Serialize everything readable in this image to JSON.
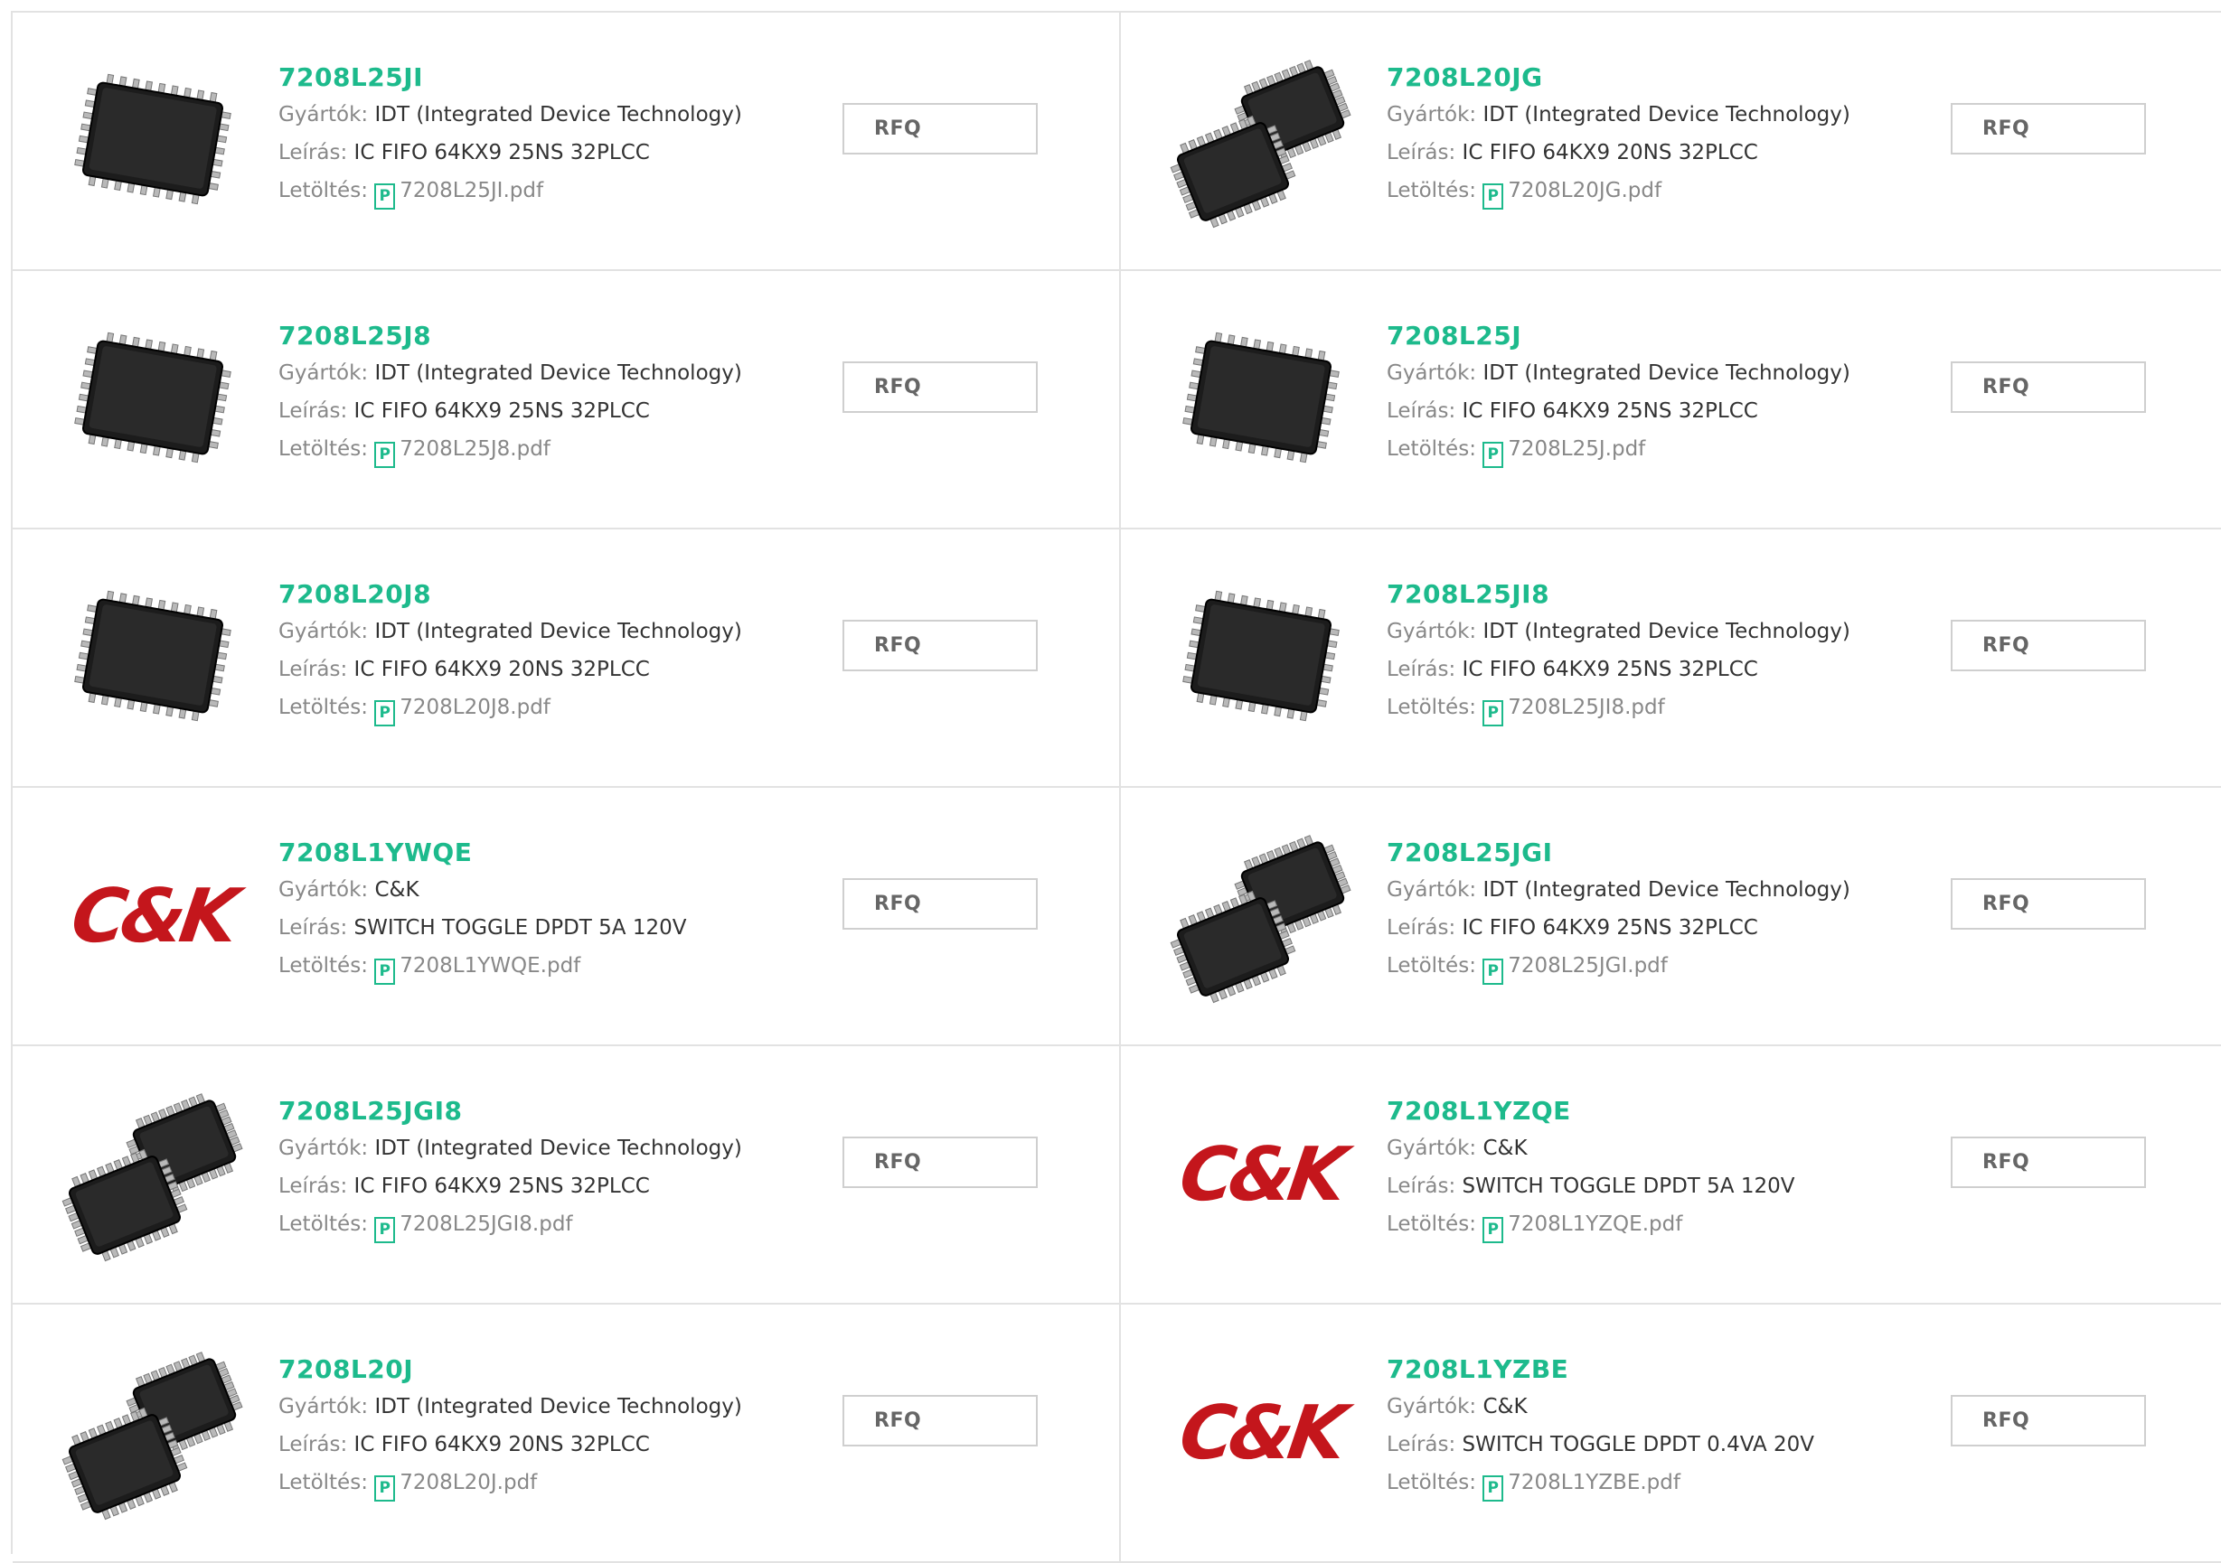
{
  "labels": {
    "manufacturer": "Gyártók:",
    "description": "Leírás:",
    "download": "Letöltés:",
    "rfq": "RFQ",
    "pdf_glyph": "P"
  },
  "logo_text": "C&K",
  "colors": {
    "accent": "#1dba8c",
    "ck_red": "#c4161c",
    "border": "#e2e2e2"
  },
  "products": [
    {
      "part": "7208L25JI",
      "manufacturer": "IDT (Integrated Device Technology)",
      "description": "IC FIFO 64KX9 25NS 32PLCC",
      "pdf": "7208L25JI.pdf",
      "image": "plcc-single-chip"
    },
    {
      "part": "7208L20JG",
      "manufacturer": "IDT (Integrated Device Technology)",
      "description": "IC FIFO 64KX9 20NS 32PLCC",
      "pdf": "7208L20JG.pdf",
      "image": "plcc-chip-pair"
    },
    {
      "part": "7208L25J8",
      "manufacturer": "IDT (Integrated Device Technology)",
      "description": "IC FIFO 64KX9 25NS 32PLCC",
      "pdf": "7208L25J8.pdf",
      "image": "plcc-single-chip"
    },
    {
      "part": "7208L25J",
      "manufacturer": "IDT (Integrated Device Technology)",
      "description": "IC FIFO 64KX9 25NS 32PLCC",
      "pdf": "7208L25J.pdf",
      "image": "plcc-single-chip"
    },
    {
      "part": "7208L20J8",
      "manufacturer": "IDT (Integrated Device Technology)",
      "description": "IC FIFO 64KX9 20NS 32PLCC",
      "pdf": "7208L20J8.pdf",
      "image": "plcc-single-chip"
    },
    {
      "part": "7208L25JI8",
      "manufacturer": "IDT (Integrated Device Technology)",
      "description": "IC FIFO 64KX9 25NS 32PLCC",
      "pdf": "7208L25JI8.pdf",
      "image": "plcc-single-chip"
    },
    {
      "part": "7208L1YWQE",
      "manufacturer": "C&K",
      "description": "SWITCH TOGGLE DPDT 5A 120V",
      "pdf": "7208L1YWQE.pdf",
      "image": "ck-logo"
    },
    {
      "part": "7208L25JGI",
      "manufacturer": "IDT (Integrated Device Technology)",
      "description": "IC FIFO 64KX9 25NS 32PLCC",
      "pdf": "7208L25JGI.pdf",
      "image": "plcc-chip-pair"
    },
    {
      "part": "7208L25JGI8",
      "manufacturer": "IDT (Integrated Device Technology)",
      "description": "IC FIFO 64KX9 25NS 32PLCC",
      "pdf": "7208L25JGI8.pdf",
      "image": "plcc-chip-pair"
    },
    {
      "part": "7208L1YZQE",
      "manufacturer": "C&K",
      "description": "SWITCH TOGGLE DPDT 5A 120V",
      "pdf": "7208L1YZQE.pdf",
      "image": "ck-logo"
    },
    {
      "part": "7208L20J",
      "manufacturer": "IDT (Integrated Device Technology)",
      "description": "IC FIFO 64KX9 20NS 32PLCC",
      "pdf": "7208L20J.pdf",
      "image": "plcc-chip-pair"
    },
    {
      "part": "7208L1YZBE",
      "manufacturer": "C&K",
      "description": "SWITCH TOGGLE DPDT 0.4VA 20V",
      "pdf": "7208L1YZBE.pdf",
      "image": "ck-logo"
    }
  ]
}
